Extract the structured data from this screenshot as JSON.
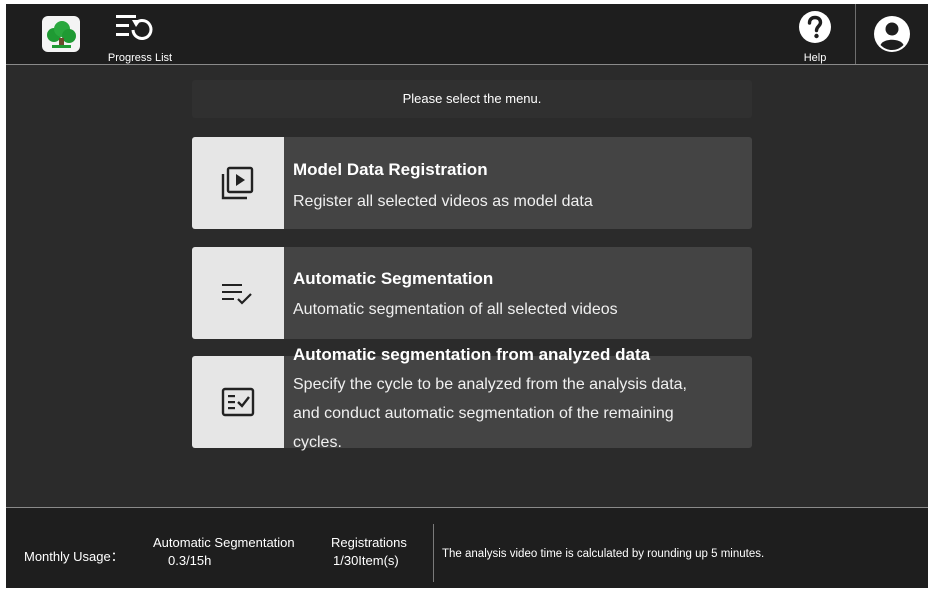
{
  "header": {
    "logo_icon": "tree-logo",
    "progress_list_label": "Progress List",
    "progress_icon": "list-history-icon",
    "help_label": "Help",
    "help_icon": "question-circle-icon",
    "user_icon": "user-account-icon"
  },
  "main": {
    "prompt": "Please select the menu.",
    "cards": [
      {
        "title": "Model Data Registration",
        "description": "Register all selected videos as model data",
        "icon": "video-library-icon"
      },
      {
        "title": "Automatic Segmentation",
        "description": "Automatic segmentation of all selected videos",
        "icon": "checklist-icon"
      },
      {
        "title": "Automatic segmentation from analyzed data",
        "description_lines": [
          "Specify the cycle to be analyzed from the analysis data,",
          "and conduct automatic segmentation of the remaining",
          "cycles."
        ],
        "icon": "fact-check-icon"
      }
    ]
  },
  "footer": {
    "monthly_usage_label": "Monthly Usage：",
    "segmentation_title": "Automatic Segmentation",
    "segmentation_value": "0.3/15h",
    "registrations_title": "Registrations",
    "registrations_value": "1/30Item(s)",
    "note": "The analysis video time is calculated by rounding up 5 minutes."
  },
  "colors": {
    "header_bg": "#1e1e1e",
    "main_bg": "#2b2b2b",
    "card_bg": "#444444",
    "icon_tile_bg": "#e6e6e6",
    "logo_green": "#1f9a33"
  }
}
